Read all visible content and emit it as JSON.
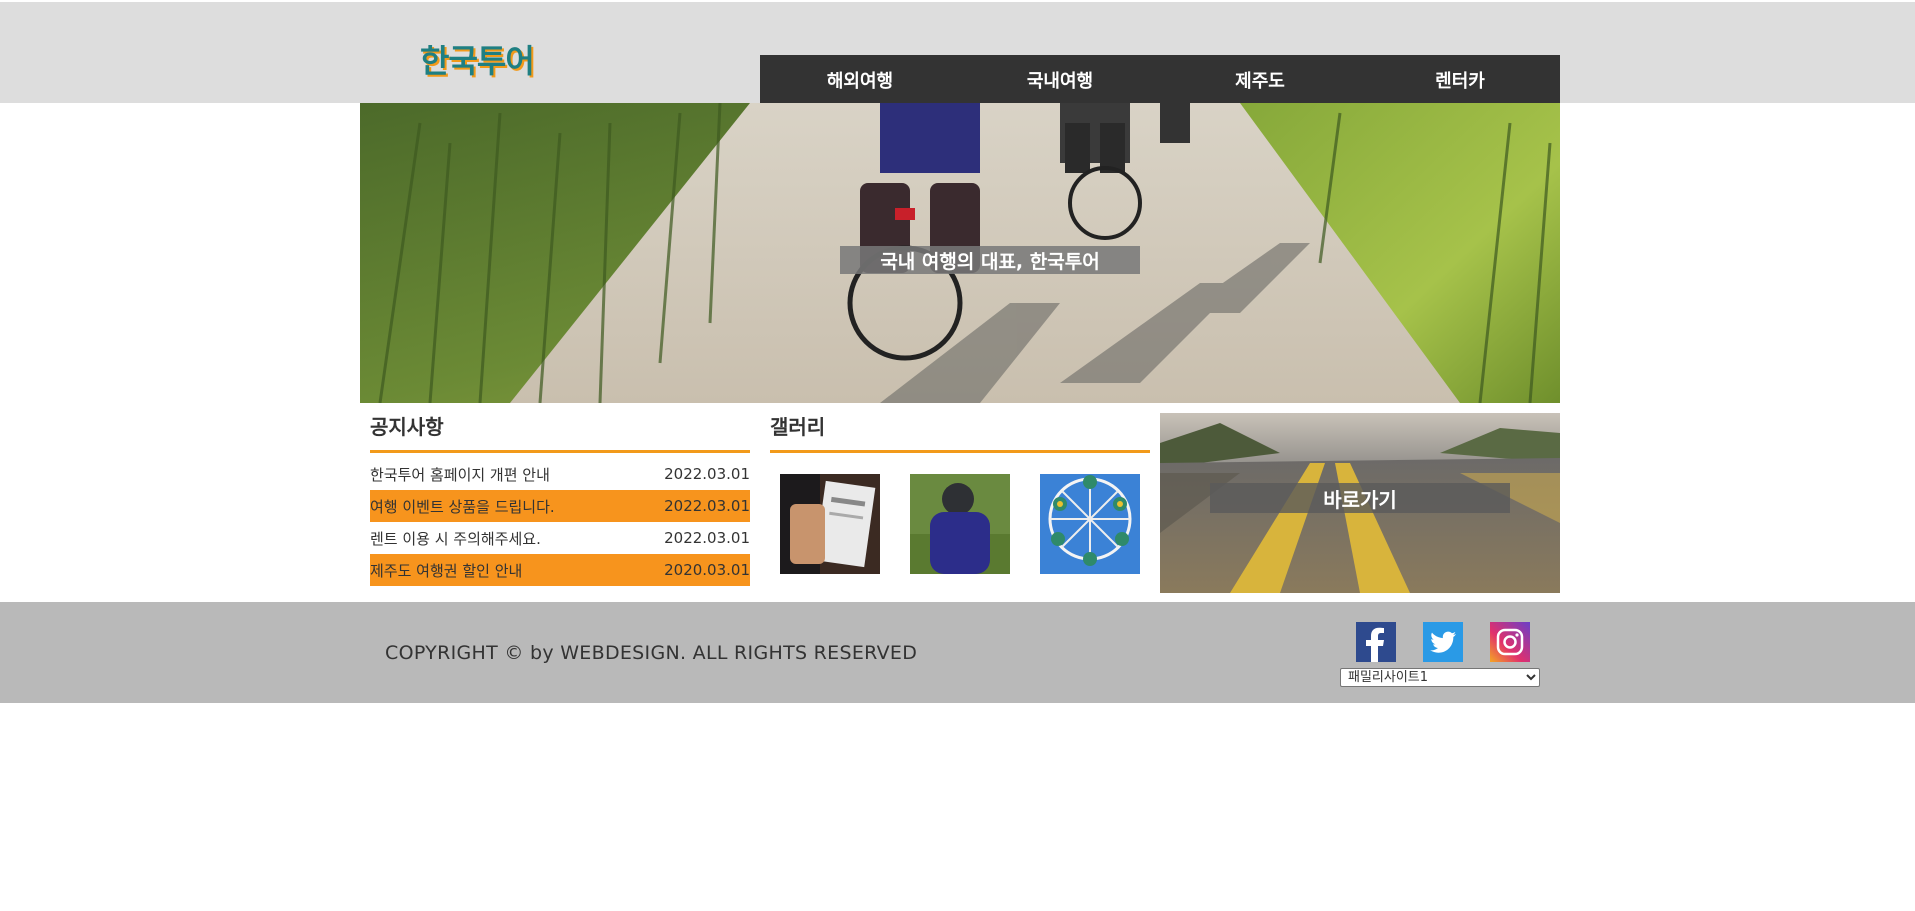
{
  "header": {
    "logo": "한국투어",
    "nav": [
      "해외여행",
      "국내여행",
      "제주도",
      "렌터카"
    ]
  },
  "hero": {
    "caption": "국내 여행의 대표, 한국투어"
  },
  "notice": {
    "title": "공지사항",
    "items": [
      {
        "text": "한국투어 홈페이지 개편 안내",
        "date": "2022.03.01"
      },
      {
        "text": "여행 이벤트 상품을 드립니다.",
        "date": "2022.03.01"
      },
      {
        "text": "렌트 이용 시 주의해주세요.",
        "date": "2022.03.01"
      },
      {
        "text": "제주도 여행권 할인 안내",
        "date": "2020.03.01"
      }
    ]
  },
  "gallery": {
    "title": "갤러리"
  },
  "shortcut": {
    "label": "바로가기"
  },
  "footer": {
    "copyright": "COPYRIGHT © by WEBDESIGN. ALL RIGHTS RESERVED",
    "family_select": "패밀리사이트1"
  },
  "colors": {
    "accent": "#f7941d",
    "nav_bg": "#333333",
    "header_bg": "#dddddd",
    "footer_bg": "#b9b9b9"
  }
}
